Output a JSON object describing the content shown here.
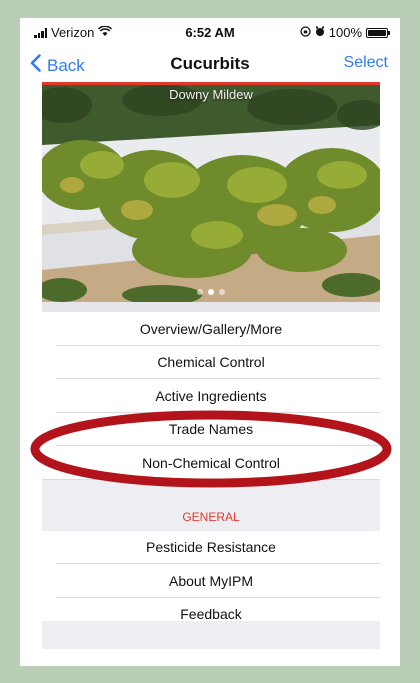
{
  "status_bar": {
    "carrier": "Verizon",
    "time": "6:52 AM",
    "battery": "100%",
    "battery_level": 1.0
  },
  "nav_bar": {
    "back_label": "Back",
    "title": "Cucurbits",
    "select_label": "Select"
  },
  "hero": {
    "caption": "Downy Mildew",
    "page_count": 3,
    "active_page": 2
  },
  "menu": {
    "items": [
      {
        "label": "Overview/Gallery/More"
      },
      {
        "label": "Chemical Control"
      },
      {
        "label": "Active Ingredients"
      },
      {
        "label": "Trade Names"
      },
      {
        "label": "Non-Chemical Control"
      }
    ]
  },
  "general": {
    "header": "GENERAL",
    "items": [
      {
        "label": "Pesticide Resistance"
      },
      {
        "label": "About MyIPM"
      },
      {
        "label": "Feedback"
      }
    ]
  },
  "colors": {
    "accent": "#2f7bf5",
    "red": "#e0392b",
    "annotation": "#b3141b",
    "backdrop": "#b9cdb7"
  }
}
